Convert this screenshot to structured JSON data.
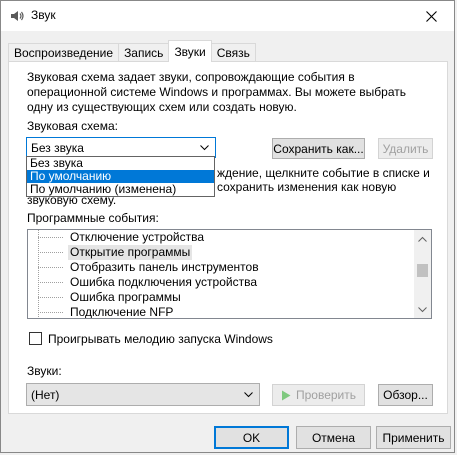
{
  "window": {
    "title": "Звук",
    "icon": "speaker-icon",
    "close_icon": "close-icon"
  },
  "tabs": [
    {
      "label": "Воспроизведение",
      "active": false
    },
    {
      "label": "Запись",
      "active": false
    },
    {
      "label": "Звуки",
      "active": true
    },
    {
      "label": "Связь",
      "active": false
    }
  ],
  "description": "Звуковая схема задает звуки, сопровождающие события в операционной системе Windows и программах. Вы можете выбрать одну из существующих схем или создать новую.",
  "scheme": {
    "label": "Звуковая схема:",
    "value": "Без звука",
    "options": [
      "Без звука",
      "По умолчанию",
      "По умолчанию (изменена)"
    ],
    "highlighted_option": "По умолчанию",
    "save_button": "Сохранить как...",
    "delete_button": "Удалить"
  },
  "hint": {
    "line1": "ждение, щелкните событие в списке и",
    "line2": "сохранить изменения как новую",
    "line3": "звуковую схему."
  },
  "events": {
    "label": "Программные события:",
    "items": [
      "Отключение устройства",
      "Открытие программы",
      "Отобразить панель инструментов",
      "Ошибка подключения устройства",
      "Ошибка программы",
      "Подключение NFP"
    ],
    "selected": "Открытие программы"
  },
  "startup_checkbox": {
    "label": "Проигрывать мелодию запуска Windows",
    "checked": false
  },
  "sounds": {
    "label": "Звуки:",
    "value": "(Нет)",
    "test_button": "Проверить",
    "browse_button": "Обзор..."
  },
  "footer": {
    "ok": "OK",
    "cancel": "Отмена",
    "apply": "Применить"
  },
  "colors": {
    "accent": "#0078d7",
    "disabled_text": "#a0a0a0",
    "play_icon": "#7fc97f"
  }
}
